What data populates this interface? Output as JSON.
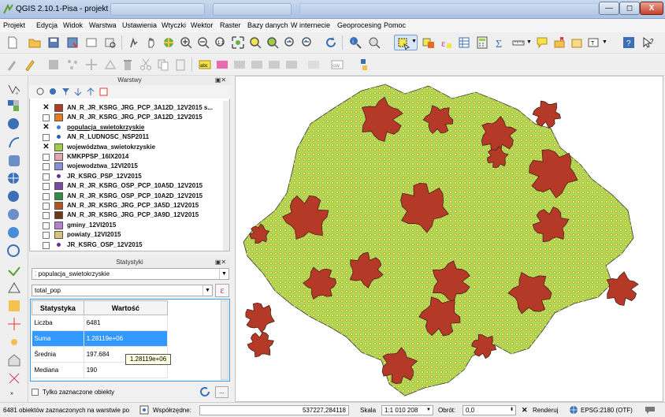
{
  "window": {
    "title": "QGIS 2.10.1-Pisa - projekt",
    "buttons": [
      "—",
      "◻",
      "X"
    ]
  },
  "menu": [
    "Projekt",
    "Edycja",
    "Widok",
    "Warstwa",
    "Ustawienia",
    "Wtyczki",
    "Wektor",
    "Raster",
    "Bazy danych",
    "W internecie",
    "Geoprocesing",
    "Pomoc"
  ],
  "layers_panel": {
    "title": "Warstwy",
    "layers": [
      {
        "name": "AN_R_JR_KSRG_JRG_PCP_3A12D_12V2015 s...",
        "checked": true,
        "color": "#b33a2a",
        "kind": "polygon"
      },
      {
        "name": "AN_R_JR_KSRG_JRG_PCP_3A12D_12V2015",
        "checked": false,
        "color": "#e87b1e",
        "kind": "polygon"
      },
      {
        "name": "populacja_swietokrzyskie",
        "checked": true,
        "color": "#3a7fd4",
        "kind": "point"
      },
      {
        "name": "AN_R_LUDNOSC_NSP2011",
        "checked": false,
        "color": "#2b5db5",
        "kind": "point"
      },
      {
        "name": "województwa_swietokrzyskie",
        "checked": true,
        "color": "#9fcf45",
        "kind": "polygon"
      },
      {
        "name": "KMKPPSP_16IX2014",
        "checked": false,
        "color": "#e3a3b0",
        "kind": "polygon"
      },
      {
        "name": "wojewodztwa_12VI2015",
        "checked": false,
        "color": "#8b8fd8",
        "kind": "polygon"
      },
      {
        "name": "JR_KSRG_PSP_12V2015",
        "checked": false,
        "color": "#6b2d8c",
        "kind": "point"
      },
      {
        "name": "AN_R_JR_KSRG_OSP_PCP_10A5D_12V2015",
        "checked": false,
        "color": "#7a4aa0",
        "kind": "polygon"
      },
      {
        "name": "AN_R_JR_KSRG_OSP_PCP_10A2D_12V2015",
        "checked": false,
        "color": "#2f8f3c",
        "kind": "polygon"
      },
      {
        "name": "AN_R_JR_KSRG_JRG_PCP_3A5D_12V2015",
        "checked": false,
        "color": "#b0561e",
        "kind": "polygon"
      },
      {
        "name": "AN_R_JR_KSRG_JRG_PCP_3A9D_12V2015",
        "checked": false,
        "color": "#6b3a14",
        "kind": "polygon"
      },
      {
        "name": "gminy_12VI2015",
        "checked": false,
        "color": "#b77fd0",
        "kind": "polygon"
      },
      {
        "name": "powiaty_12VI2015",
        "checked": false,
        "color": "#d6c27a",
        "kind": "polygon"
      },
      {
        "name": "JR_KSRG_OSP_12V2015",
        "checked": false,
        "color": "#6b2d8c",
        "kind": "point"
      }
    ]
  },
  "stats_panel": {
    "title": "Statystyki",
    "layer_select": "populacja_swietokrzyskie",
    "field_select": "total_pop",
    "expression_icon": "ε",
    "table_headers": [
      "Statystyka",
      "Wartość"
    ],
    "rows": [
      {
        "stat": "Liczba",
        "value": "6481",
        "selected": false
      },
      {
        "stat": "Suma",
        "value": "1.28119e+06",
        "selected": true
      },
      {
        "stat": "Średnia",
        "value": "197.684",
        "selected": false
      },
      {
        "stat": "Mediana",
        "value": "190",
        "selected": false
      }
    ],
    "tooltip": "1.28119e+06",
    "only_selected_label": "Tylko zaznaczone obiekty"
  },
  "statusbar": {
    "message": "6481 obiektów zaznaczonych na warstwie po",
    "coord_label": "Współrzędne:",
    "coord_value": "537227,284118",
    "scale_label": "Skala",
    "scale_value": "1:1 010 208",
    "rotation_label": "Obrót:",
    "rotation_value": "0,0",
    "render_label": "Renderuj",
    "crs": "EPSG:2180 (OTF)"
  },
  "colors": {
    "region_fill": "#b0d85c",
    "points": "#f2e64a",
    "zones": "#b43a27",
    "selection": "#3399ff"
  }
}
